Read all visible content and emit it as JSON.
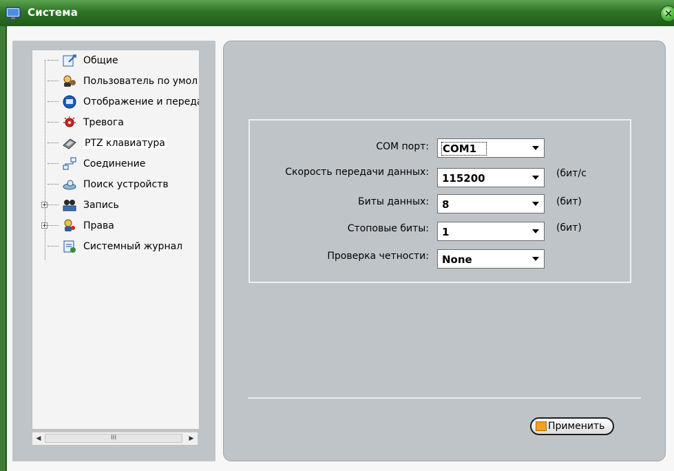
{
  "window": {
    "title": "Система",
    "close_glyph": "✕",
    "icon": "computer-monitor-icon"
  },
  "tree": {
    "items": [
      {
        "label": "Общие",
        "icon": "general-settings-icon",
        "expander": ""
      },
      {
        "label": "Пользователь по умол",
        "icon": "user-default-icon",
        "expander": ""
      },
      {
        "label": "Отображение и переда",
        "icon": "display-icon",
        "expander": ""
      },
      {
        "label": "Тревога",
        "icon": "alarm-icon",
        "expander": ""
      },
      {
        "label": "PTZ клавиатура",
        "icon": "ptz-keyboard-icon",
        "expander": "",
        "selected": true
      },
      {
        "label": "Соединение",
        "icon": "network-icon",
        "expander": ""
      },
      {
        "label": "Поиск устройств",
        "icon": "device-search-icon",
        "expander": ""
      },
      {
        "label": "Запись",
        "icon": "record-icon",
        "expander": "+"
      },
      {
        "label": "Права",
        "icon": "rights-icon",
        "expander": "+"
      },
      {
        "label": "Системный журнал",
        "icon": "system-log-icon",
        "expander": ""
      }
    ],
    "scroll_left": "◀",
    "scroll_right": "▶",
    "scroll_thumb": "III"
  },
  "form": {
    "com_port": {
      "label": "COM порт:",
      "value": "COM1"
    },
    "baud_rate": {
      "label": "Скорость передачи данных:",
      "value": "115200",
      "unit": "(бит/с"
    },
    "data_bits": {
      "label": "Биты данных:",
      "value": "8",
      "unit": "(бит)"
    },
    "stop_bits": {
      "label": "Стоповые биты:",
      "value": "1",
      "unit": "(бит)"
    },
    "parity": {
      "label": "Проверка четности:",
      "value": "None"
    }
  },
  "apply_button": {
    "label": "Применить"
  }
}
